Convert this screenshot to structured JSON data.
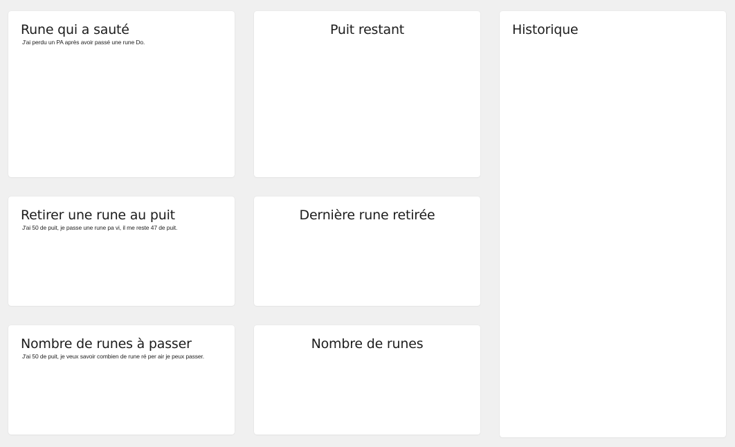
{
  "cards": {
    "rune_sautee": {
      "title": "Rune qui a sauté",
      "description": "J'ai perdu un PA après avoir passé une rune Do."
    },
    "puit_restant": {
      "title": "Puit restant"
    },
    "historique": {
      "title": "Historique"
    },
    "retirer_rune": {
      "title": "Retirer une rune au puit",
      "description": "J'ai 50 de puit, je passe une rune pa vi, il me reste 47 de puit."
    },
    "derniere_rune": {
      "title": "Dernière rune retirée"
    },
    "nombre_passer": {
      "title": "Nombre de runes à passer",
      "description": "J'ai 50 de puit, je veux savoir combien de rune ré per air je peux passer."
    },
    "nombre_runes": {
      "title": "Nombre de runes"
    }
  }
}
